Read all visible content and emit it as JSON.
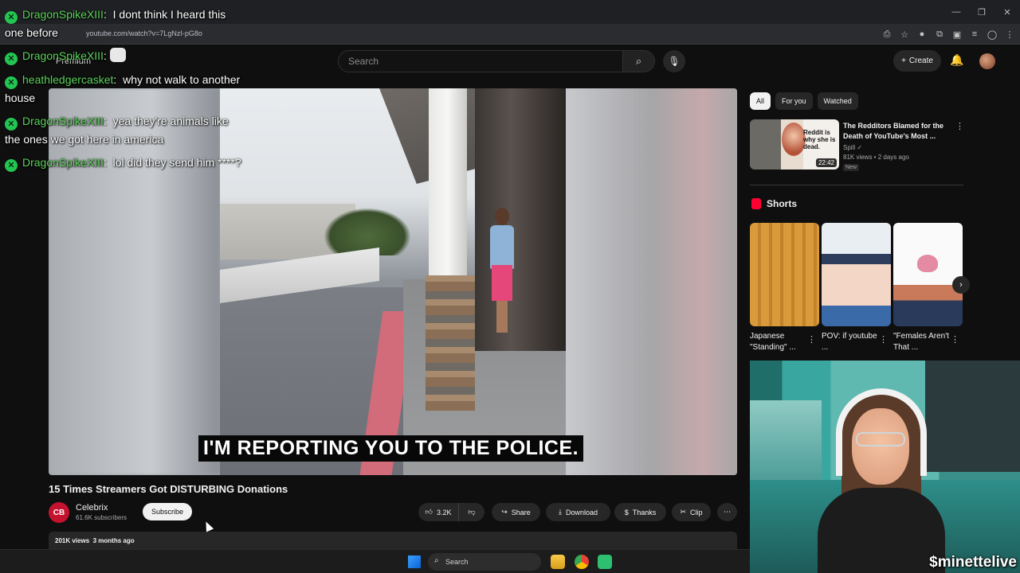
{
  "browser": {
    "url": "youtube.com/watch?v=7LgNzI-pG8o",
    "window_controls": [
      "—",
      "❐",
      "✕"
    ]
  },
  "header": {
    "logo_text": "Premium",
    "search_placeholder": "Search",
    "create_label": "Create"
  },
  "video": {
    "caption": "I'M REPORTING YOU TO THE POLICE.",
    "title": "15 Times Streamers Got DISTURBING Donations",
    "channel": {
      "avatar_text": "CB",
      "name": "Celebrix",
      "subscribers": "61.6K subscribers",
      "subscribe_label": "Subscribe"
    },
    "actions": {
      "likes": "3.2K",
      "share": "Share",
      "download": "Download",
      "thanks": "Thanks",
      "clip": "Clip"
    },
    "views": "201K views",
    "age": "3 months ago"
  },
  "sidebar": {
    "chips": [
      {
        "label": "All",
        "active": true
      },
      {
        "label": "For you",
        "active": false
      },
      {
        "label": "Watched",
        "active": false
      }
    ],
    "recommended": {
      "title": "The Redditors Blamed for the Death of YouTube's Most ...",
      "channel": "Spill",
      "meta": "81K views • 2 days ago",
      "badge": "New",
      "duration": "22:42",
      "thumb_text": "Reddit is why she is dead."
    },
    "shorts_title": "Shorts",
    "shorts": [
      {
        "label": "Japanese \"Standing\" ..."
      },
      {
        "label": "POV: if youtube ..."
      },
      {
        "label": "\"Females Aren't That ..."
      }
    ]
  },
  "chat": [
    {
      "user": "DragonSpikeXIII",
      "message": "I dont think I heard this one before"
    },
    {
      "user": "DragonSpikeXIII",
      "message": ""
    },
    {
      "user": "heathledgercasket",
      "message": "why not walk to another house"
    },
    {
      "user": "DragonSpikeXIII",
      "message": "yea they're animals like the ones we got here in america"
    },
    {
      "user": "DragonSpikeXIII",
      "message": "lol did they send him ****?"
    }
  ],
  "webcam": {
    "handle": "$minettelive"
  },
  "taskbar": {
    "search_label": "Search"
  },
  "colors": {
    "chat_username": "#5bd35a",
    "youtube_red": "#ff0033",
    "background": "#0f0f0f"
  }
}
